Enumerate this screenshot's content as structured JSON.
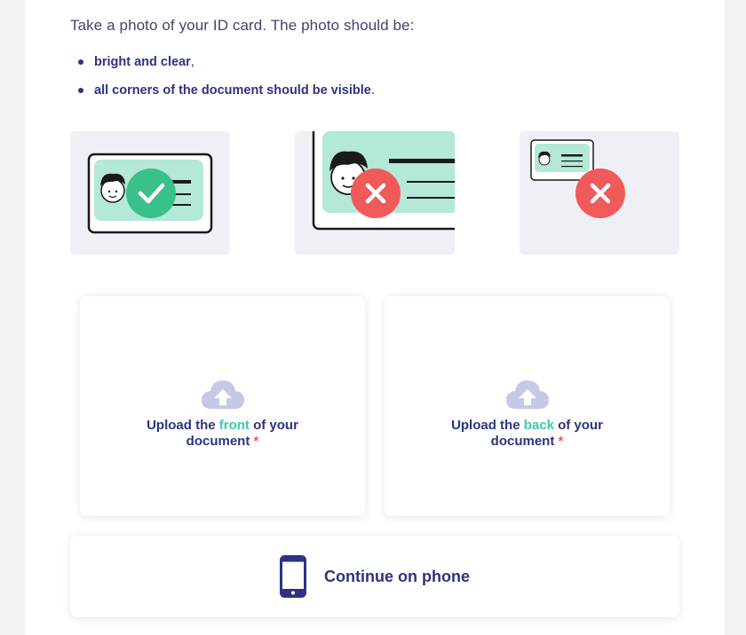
{
  "instructions": {
    "intro": "Take a photo of your ID card. The photo should be:",
    "requirements": [
      {
        "text": "bright and clear",
        "punct": ","
      },
      {
        "text": "all corners of the document should be visible",
        "punct": "."
      }
    ]
  },
  "examples": [
    {
      "status": "good",
      "icon": "check-icon"
    },
    {
      "status": "bad-too-close",
      "icon": "cross-icon"
    },
    {
      "status": "bad-too-small",
      "icon": "cross-icon"
    }
  ],
  "uploads": {
    "front": {
      "prefix": "Upload the ",
      "highlight": "front",
      "suffix": " of your document",
      "required": "*",
      "icon": "cloud-upload-icon"
    },
    "back": {
      "prefix": "Upload the ",
      "highlight": "back",
      "suffix": " of your document",
      "required": "*",
      "icon": "cloud-upload-icon"
    }
  },
  "continue_phone": {
    "label": "Continue on phone",
    "icon": "smartphone-icon"
  },
  "colors": {
    "primary": "#2d3382",
    "accent": "#3fc8b0",
    "success": "#3ac08a",
    "error": "#f05a5a",
    "tile_bg": "#eef0f6",
    "card_fill": "#b4e8d8"
  }
}
